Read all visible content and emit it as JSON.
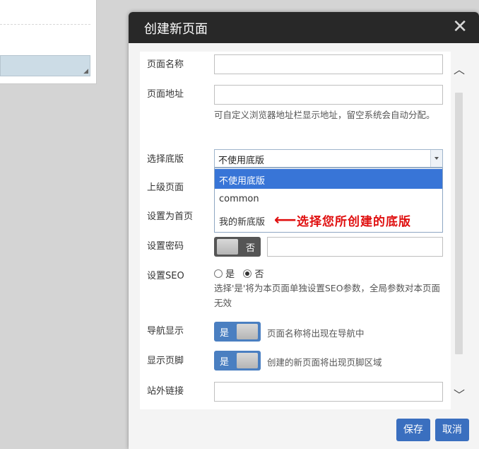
{
  "modal": {
    "title": "创建新页面",
    "close_symbol": "✕",
    "save_label": "保存",
    "cancel_label": "取消"
  },
  "form": {
    "page_name_label": "页面名称",
    "page_address_label": "页面地址",
    "page_address_help": "可自定义浏览器地址栏显示地址，留空系统会自动分配。",
    "template_label": "选择底版",
    "template_selected": "不使用底版",
    "template_options": [
      "不使用底版",
      "common",
      "我的新底版"
    ],
    "parent_label": "上级页面",
    "homepage_label": "设置为首页",
    "password_label": "设置密码",
    "password_toggle_text": "否",
    "seo_label": "设置SEO",
    "seo_options": [
      "是",
      "否"
    ],
    "seo_help": "选择'是'将为本页面单独设置SEO参数，全局参数对本页面无效",
    "nav_label": "导航显示",
    "nav_toggle_text": "是",
    "nav_desc": "页面名称将出现在导航中",
    "footer_label": "显示页脚",
    "footer_toggle_text": "是",
    "footer_desc": "创建的新页面将出现页脚区域",
    "external_link_label": "站外链接"
  },
  "annotation": {
    "arrow": "⟵",
    "text": "选择您所创建的底版"
  },
  "colors": {
    "header_bg": "#282828",
    "accent_blue": "#3875d7",
    "annotation_red": "#e01010"
  }
}
